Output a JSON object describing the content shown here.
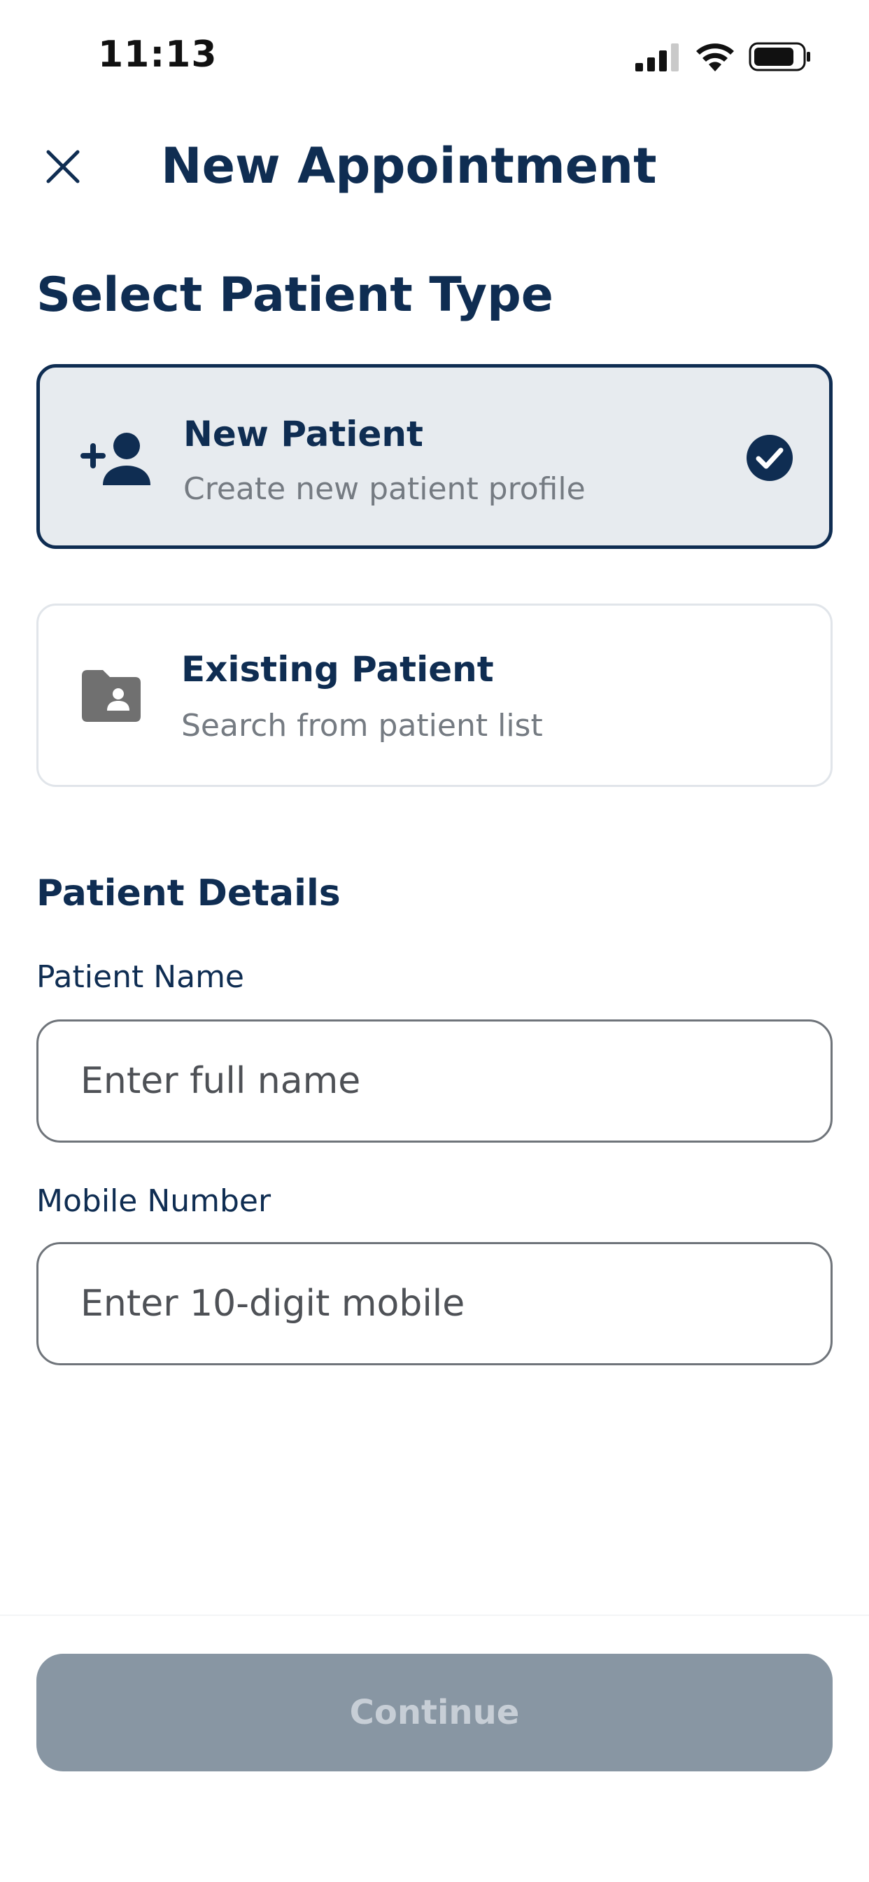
{
  "status_bar": {
    "time": "11:13",
    "icons": [
      "signal-icon",
      "wifi-icon",
      "battery-icon"
    ]
  },
  "header": {
    "title": "New Appointment",
    "close_icon": "close-icon"
  },
  "patient_type": {
    "section_title": "Select Patient Type",
    "options": [
      {
        "title": "New Patient",
        "subtitle": "Create new patient profile",
        "icon": "person-add-icon",
        "selected": true
      },
      {
        "title": "Existing Patient",
        "subtitle": "Search from patient list",
        "icon": "folder-person-icon",
        "selected": false
      }
    ]
  },
  "patient_details": {
    "section_title": "Patient Details",
    "name_label": "Patient Name",
    "name_placeholder": "Enter full name",
    "name_value": "",
    "mobile_label": "Mobile Number",
    "mobile_placeholder": "Enter 10-digit mobile",
    "mobile_value": ""
  },
  "footer": {
    "continue_label": "Continue",
    "continue_enabled": false
  },
  "colors": {
    "primary": "#0f2d52",
    "selected_bg": "#e7ebef",
    "disabled_button": "#8896a3",
    "disabled_text": "#c7ced6",
    "muted_text": "#757b82"
  }
}
